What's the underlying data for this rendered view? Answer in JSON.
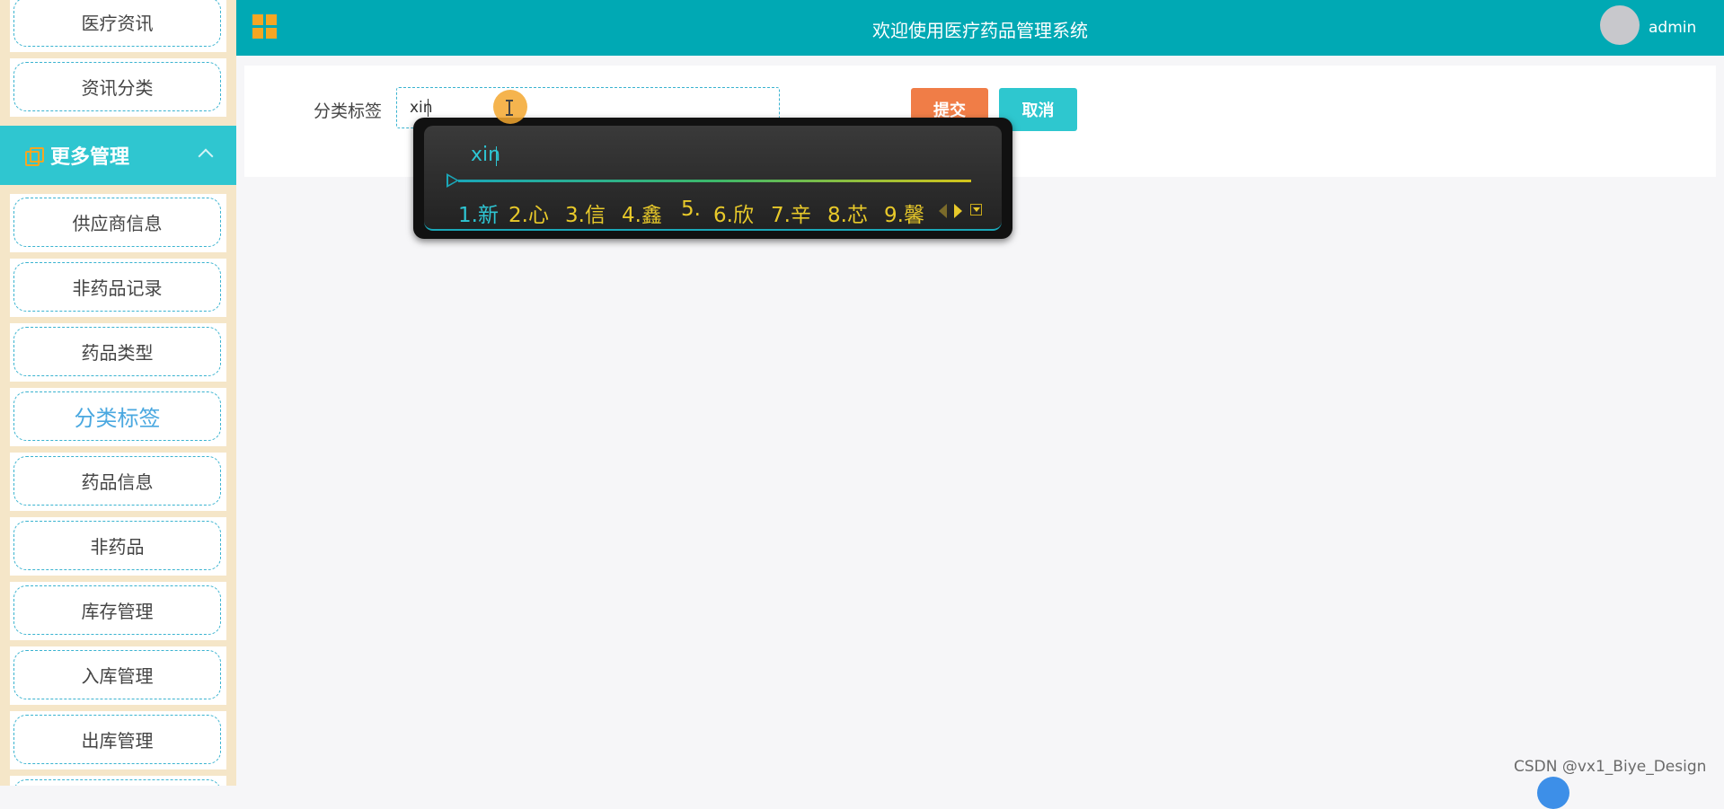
{
  "header": {
    "title": "欢迎使用医疗药品管理系统",
    "username": "admin"
  },
  "sidebar": {
    "top_items": [
      {
        "label": "医疗资讯"
      },
      {
        "label": "资讯分类"
      }
    ],
    "group": {
      "title": "更多管理"
    },
    "items": [
      {
        "label": "供应商信息"
      },
      {
        "label": "非药品记录"
      },
      {
        "label": "药品类型"
      },
      {
        "label": "分类标签",
        "active": true
      },
      {
        "label": "药品信息"
      },
      {
        "label": "非药品"
      },
      {
        "label": "库存管理"
      },
      {
        "label": "入库管理"
      },
      {
        "label": "出库管理"
      }
    ]
  },
  "form": {
    "field_label": "分类标签",
    "field_value": "xin",
    "submit_label": "提交",
    "cancel_label": "取消"
  },
  "ime": {
    "composition": "xin",
    "candidates": [
      "1.新",
      "2.心",
      "3.信",
      "4.鑫",
      "5.",
      "6.欣",
      "7.辛",
      "8.芯",
      "9.馨"
    ]
  },
  "watermark": "CSDN @vx1_Biye_Design",
  "colors": {
    "header": "#00a9b4",
    "sidebar_bg": "#f5e6c8",
    "group_bg": "#2fc6d0",
    "submit": "#f07d47",
    "cancel": "#2ec7cf",
    "accent_icon": "#f5a623"
  }
}
